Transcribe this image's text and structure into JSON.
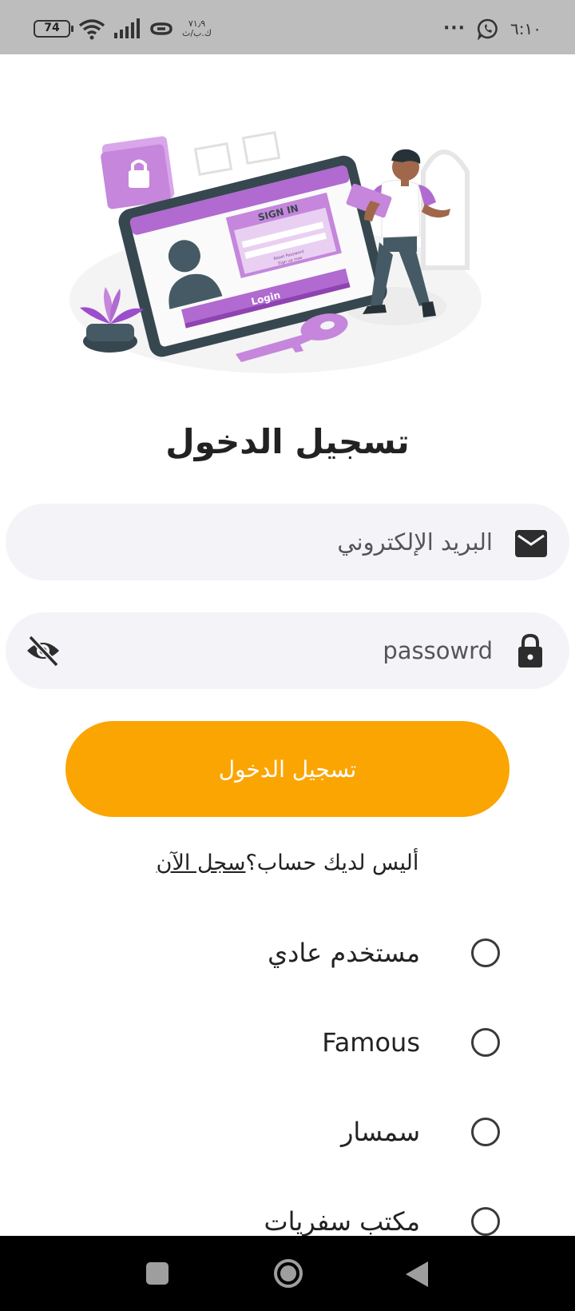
{
  "status_bar": {
    "battery": "74",
    "net_speed_value": "٧١٫٩",
    "net_speed_unit": "ك.ب/ث",
    "more": "···",
    "time": "٦:١٠"
  },
  "illustration": {
    "screen_heading": "SIGN IN",
    "reset_text": "Reset Password",
    "signup_text": "Sign up now",
    "login_text": "Login"
  },
  "login_form": {
    "title": "تسجيل الدخول",
    "email_placeholder": "البريد الإلكتروني",
    "password_placeholder": "passowrd",
    "login_button": "تسجيل الدخول",
    "no_account_text": "أليس لديك حساب؟",
    "register_link": "سجل الآن"
  },
  "user_types": [
    {
      "label": "مستخدم عادي"
    },
    {
      "label": "Famous"
    },
    {
      "label": "سمسار"
    },
    {
      "label": "مكتب سفريات"
    }
  ],
  "colors": {
    "accent": "#fba503",
    "field_bg": "#f4f3f8",
    "illustration_purple": "#b06ad0"
  }
}
